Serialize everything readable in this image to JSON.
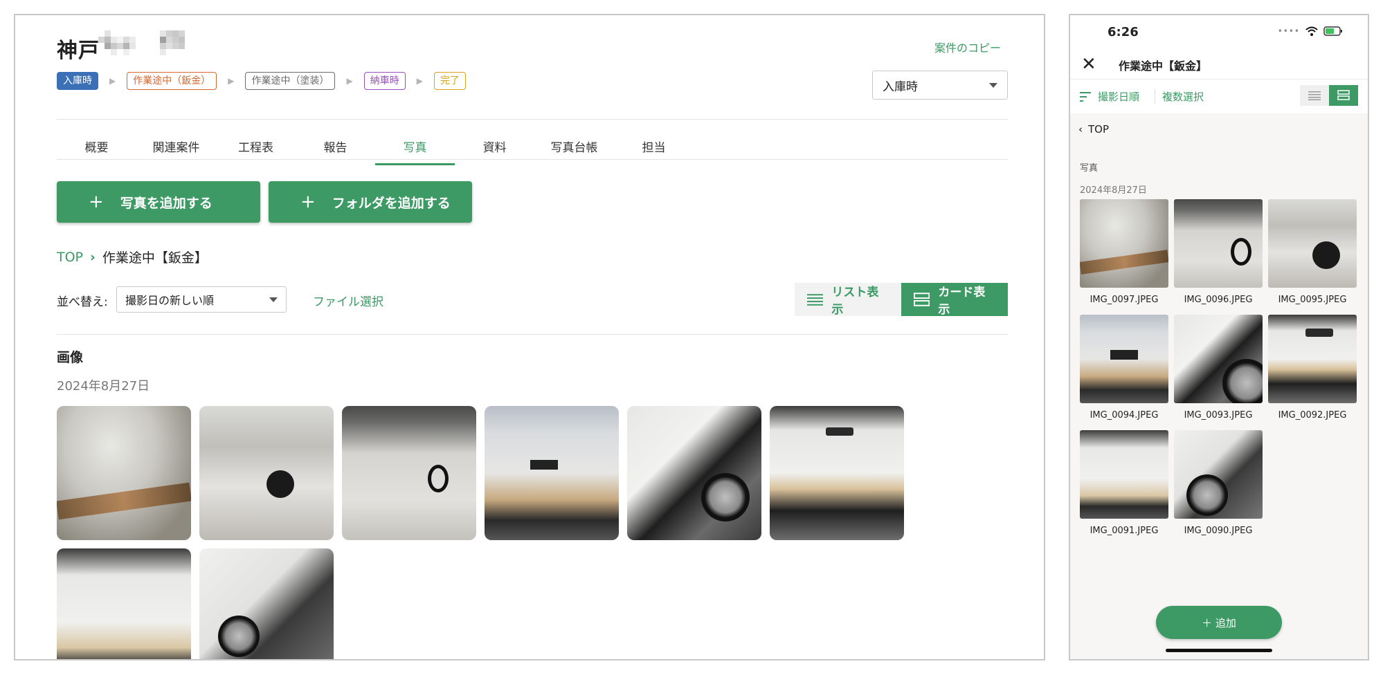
{
  "desktop": {
    "title": "神戸",
    "copy_link": "案件のコピー",
    "statuses": [
      {
        "label": "入庫時",
        "color": "#3b6fb6"
      },
      {
        "label": "作業途中（鈑金）",
        "color": "#d9662c"
      },
      {
        "label": "作業途中（塗装）",
        "color": "#6b6b6b"
      },
      {
        "label": "納車時",
        "color": "#9a4fc0"
      },
      {
        "label": "完了",
        "color": "#d9a21c"
      }
    ],
    "stage_select": {
      "value": "入庫時"
    },
    "tabs": [
      "概要",
      "関連案件",
      "工程表",
      "報告",
      "写真",
      "資料",
      "写真台帳",
      "担当"
    ],
    "active_tab": "写真",
    "add_photo_button": "写真を追加する",
    "add_folder_button": "フォルダを追加する",
    "breadcrumb": {
      "root": "TOP",
      "separator": "›",
      "current": "作業途中【鈑金】"
    },
    "sort": {
      "label": "並べ替え:",
      "value": "撮影日の新しい順"
    },
    "file_select": "ファイル選択",
    "view_toggle": {
      "list": "リスト表示",
      "card": "カード表示",
      "active": "card"
    },
    "section_title": "画像",
    "section_date": "2024年8月27日",
    "photo_count": 8
  },
  "mobile": {
    "time": "6:26",
    "title": "作業途中【鈑金】",
    "sort_label": "撮影日順",
    "multi_select": "複数選択",
    "back_label": "TOP",
    "section_label": "写真",
    "date_label": "2024年8月27日",
    "photos": [
      "IMG_0097.JPEG",
      "IMG_0096.JPEG",
      "IMG_0095.JPEG",
      "IMG_0094.JPEG",
      "IMG_0093.JPEG",
      "IMG_0092.JPEG",
      "IMG_0091.JPEG",
      "IMG_0090.JPEG"
    ],
    "add_button": "＋ 追加"
  },
  "colors": {
    "accent_green": "#3d9a64",
    "link_green": "#3a9a63"
  }
}
